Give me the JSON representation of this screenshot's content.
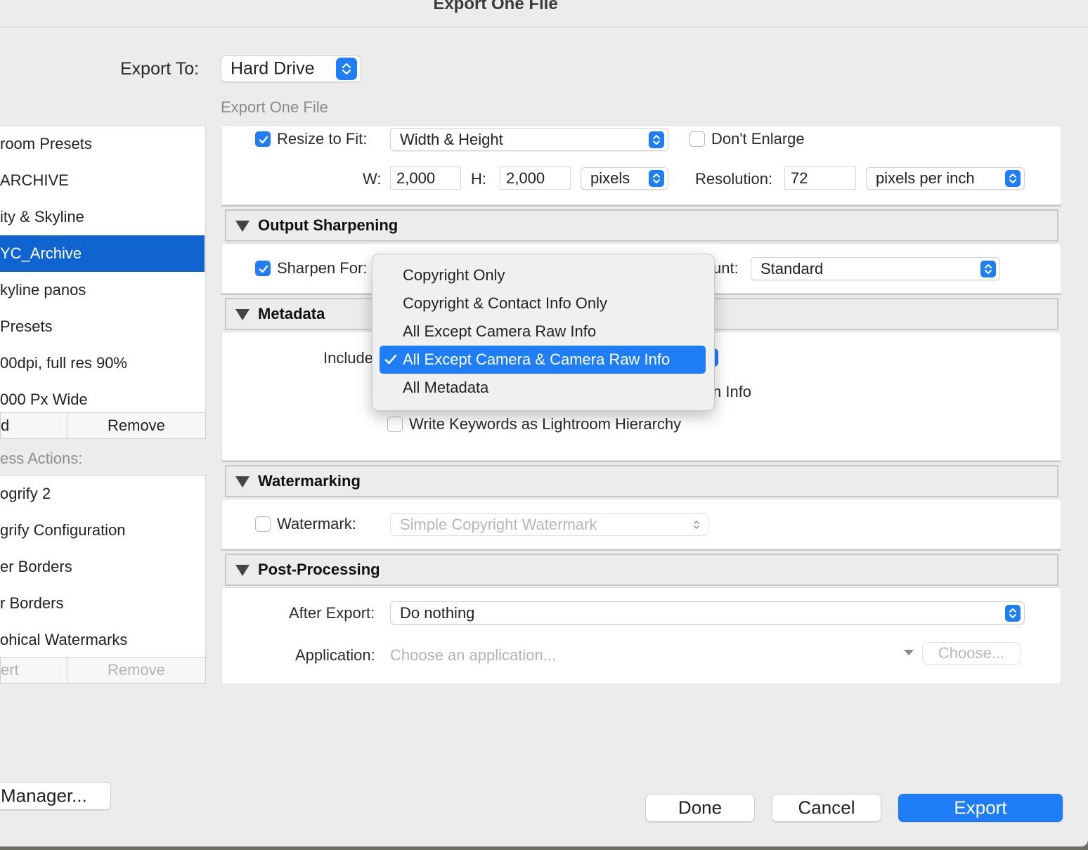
{
  "window": {
    "title": "Export One File"
  },
  "export_to": {
    "label": "Export To:",
    "value": "Hard Drive"
  },
  "preset_name": "Export One File",
  "presets": {
    "items": [
      "room Presets",
      "ARCHIVE",
      "ity & Skyline",
      "YC_Archive",
      "kyline panos",
      "Presets",
      "00dpi, full res 90%",
      "000 Px Wide"
    ],
    "selected_index": 3,
    "add_label": "d",
    "remove_label": "Remove"
  },
  "post_actions": {
    "label": "ess Actions:",
    "items": [
      "ogrify 2",
      "grify Configuration",
      "er Borders",
      "r Borders",
      "ohical Watermarks"
    ],
    "insert_label": "ert",
    "remove_label": "Remove"
  },
  "manager_button": "Manager...",
  "resize": {
    "checkbox_label": "Resize to Fit:",
    "checked": true,
    "mode": "Width & Height",
    "dont_enlarge_label": "Don't Enlarge",
    "dont_enlarge_checked": false,
    "w_label": "W:",
    "w_value": "2,000",
    "h_label": "H:",
    "h_value": "2,000",
    "units": "pixels",
    "resolution_label": "Resolution:",
    "resolution_value": "72",
    "resolution_units": "pixels per inch"
  },
  "output_sharpening": {
    "header": "Output Sharpening",
    "sharpen_label": "Sharpen For:",
    "checked": true,
    "amount_label_partial": "unt:",
    "amount_value": "Standard"
  },
  "metadata": {
    "header": "Metadata",
    "include_label": "Include",
    "option_partial": "n Info",
    "write_keywords_label": "Write Keywords as Lightroom Hierarchy",
    "write_keywords_checked": false
  },
  "metadata_menu": {
    "options": [
      "Copyright Only",
      "Copyright & Contact Info Only",
      "All Except Camera Raw Info",
      "All Except Camera & Camera Raw Info",
      "All Metadata"
    ],
    "selected_index": 3,
    "check_glyph": "✓"
  },
  "watermarking": {
    "header": "Watermarking",
    "watermark_label": "Watermark:",
    "checked": false,
    "value": "Simple Copyright Watermark"
  },
  "post_processing": {
    "header": "Post-Processing",
    "after_export_label": "After Export:",
    "after_export_value": "Do nothing",
    "application_label": "Application:",
    "application_placeholder": "Choose an application...",
    "choose_label": "Choose..."
  },
  "buttons": {
    "done": "Done",
    "cancel": "Cancel",
    "export": "Export"
  },
  "colors": {
    "accent": "#1f7ef5",
    "selection": "#0f64d2",
    "background": "#ececec"
  }
}
